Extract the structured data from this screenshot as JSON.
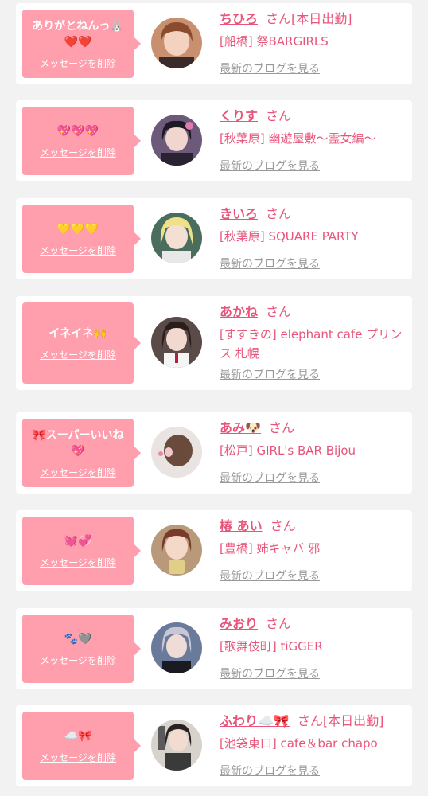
{
  "delete_label": "メッセージを削除",
  "blog_label": "最新のブログを見る",
  "san_label": "さん",
  "colors": {
    "accent": "#ff9eac",
    "text_pink": "#e8557a",
    "link_gray": "#999999"
  },
  "cards": [
    {
      "message": "ありがとねんっ🐰❤️❤️",
      "name": "ちひろ",
      "working": "[本日出勤]",
      "shop": "[船橋] 祭BARGIRLS"
    },
    {
      "message": "💖💖💖",
      "name": "くりす",
      "working": "",
      "shop": "[秋葉原] 幽遊屋敷〜霊女編〜"
    },
    {
      "message": "💛💛💛",
      "name": "きいろ",
      "working": "",
      "shop": "[秋葉原] SQUARE PARTY"
    },
    {
      "message": "イネイネ🙌",
      "name": "あかね",
      "working": "",
      "shop": "[すすきの] elephant cafe プリンス 札幌"
    },
    {
      "message": "🎀スーパーいいね💖",
      "name": "あみ🐶",
      "working": "",
      "shop": "[松戸] GIRL's BAR Bijou"
    },
    {
      "message": "💓💞",
      "name": "椿 あい",
      "working": "",
      "shop": "[豊橋] 姉キャバ 邪"
    },
    {
      "message": "🐾🩶",
      "name": "みおり",
      "working": "",
      "shop": "[歌舞伎町] tiGGER"
    },
    {
      "message": "☁️🎀",
      "name": "ふわり☁️🎀",
      "working": "[本日出勤]",
      "shop": "[池袋東口] cafe＆bar chapo"
    }
  ]
}
